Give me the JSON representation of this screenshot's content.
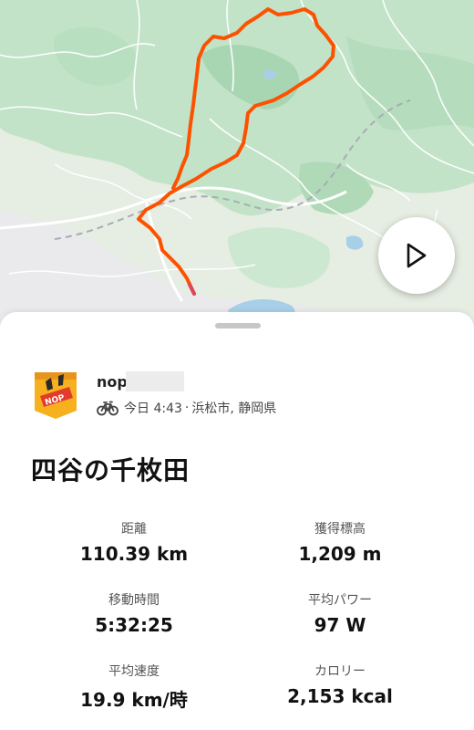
{
  "map": {
    "icons": [
      "play-icon"
    ],
    "colors": {
      "route": "#fc5200",
      "land": "#e9efe4",
      "forest": "#bfe2c4",
      "road": "#ffffff",
      "rail": "#a7adb5",
      "water": "#a8cfe8"
    }
  },
  "athlete": {
    "name": "nop",
    "date_time": "今日 4:43",
    "separator": "·",
    "location": "浜松市, 静岡県",
    "activity_icon": "bike-icon"
  },
  "activity": {
    "title": "四谷の千枚田"
  },
  "stats": [
    {
      "label": "距離",
      "value": "110.39 km"
    },
    {
      "label": "獲得標高",
      "value": "1,209 m"
    },
    {
      "label": "移動時間",
      "value": "5:32:25"
    },
    {
      "label": "平均パワー",
      "value": "97 W"
    },
    {
      "label": "平均速度",
      "value": "19.9 km/時"
    },
    {
      "label": "カロリー",
      "value": "2,153 kcal"
    }
  ]
}
